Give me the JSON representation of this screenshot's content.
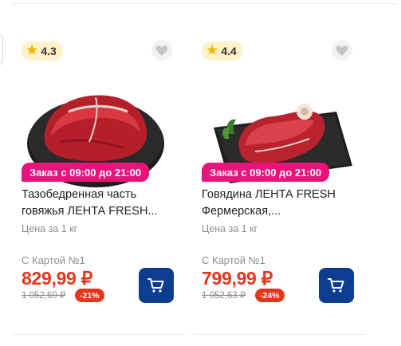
{
  "colors": {
    "promo_pink": "#e9137c",
    "price_red": "#e4361c",
    "cart_blue": "#0c3d8e",
    "rating_bg": "#fff2c9",
    "star_yellow": "#f2b600"
  },
  "products": [
    {
      "rating": "4.3",
      "promo": "Заказ с 09:00 до 21:00",
      "title_line1": "Тазобедренная часть",
      "title_line2": "говяжья ЛЕНТА FRESH...",
      "unit_price_label": "Цена за 1 кг",
      "card_label": "С Картой №1",
      "price": "829,99 ₽",
      "old_price": "1 052,69 ₽",
      "discount": "-21%",
      "image_icon": "beef-cut-on-slate-image",
      "cart_icon": "cart-icon",
      "fav_icon": "heart-icon"
    },
    {
      "rating": "4.4",
      "promo": "Заказ с 09:00 до 21:00",
      "title_line1": "Говядина ЛЕНТА FRESH",
      "title_line2": "Фермерская,...",
      "unit_price_label": "Цена за 1 кг",
      "card_label": "С Картой №1",
      "price": "799,99 ₽",
      "old_price": "1 052,63 ₽",
      "discount": "-24%",
      "image_icon": "beef-steak-on-board-image",
      "cart_icon": "cart-icon",
      "fav_icon": "heart-icon"
    }
  ]
}
